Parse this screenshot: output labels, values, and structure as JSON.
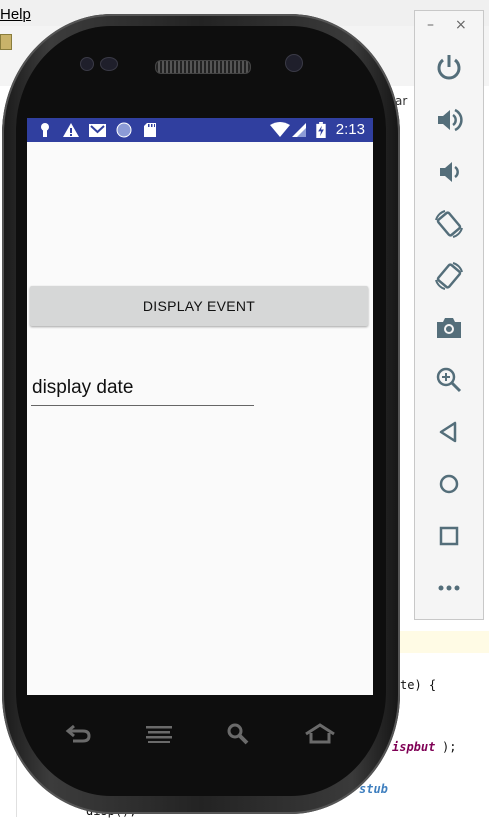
{
  "ide": {
    "menu_help": "Help",
    "tab_fragment": "ar",
    "code_lines": [
      {
        "text": "te) {",
        "class": "plain"
      },
      {
        "text": "ispbut",
        "class": "kw"
      },
      {
        "text": ");",
        "class": "plain"
      },
      {
        "text": "stub",
        "class": "cm"
      },
      {
        "text": "disp();",
        "class": "plain"
      }
    ]
  },
  "status_bar": {
    "time": "2:13",
    "color": "#303f9f"
  },
  "app": {
    "button_label": "DISPLAY EVENT",
    "text_value": "display date"
  },
  "nav_bar": {
    "icons": [
      "back-icon",
      "menu-icon",
      "search-icon",
      "home-icon"
    ]
  },
  "side_panel": {
    "minimize": "–",
    "close": "×",
    "buttons": [
      "power-icon",
      "volume-up-icon",
      "volume-down-icon",
      "rotate-left-icon",
      "rotate-right-icon",
      "camera-icon",
      "zoom-icon",
      "back-icon",
      "home-icon",
      "overview-icon",
      "more-icon"
    ],
    "icon_color": "#546e7a"
  }
}
